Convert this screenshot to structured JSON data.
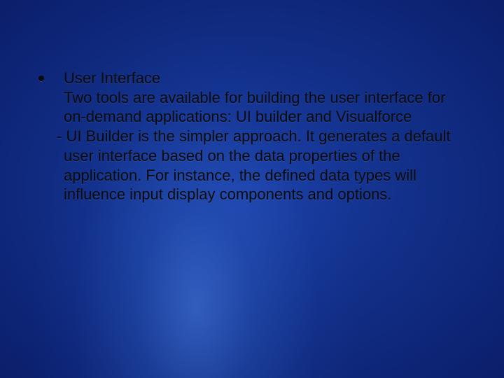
{
  "slide": {
    "bullet": {
      "heading": "User Interface",
      "intro": "Two tools are available for building the user interface for on-demand applications: UI builder and Visualforce",
      "dash_item": "- UI Builder is the simpler approach.  It generates a default user interface based on the data properties of the application.  For instance, the defined data types will influence input display components and options."
    }
  }
}
